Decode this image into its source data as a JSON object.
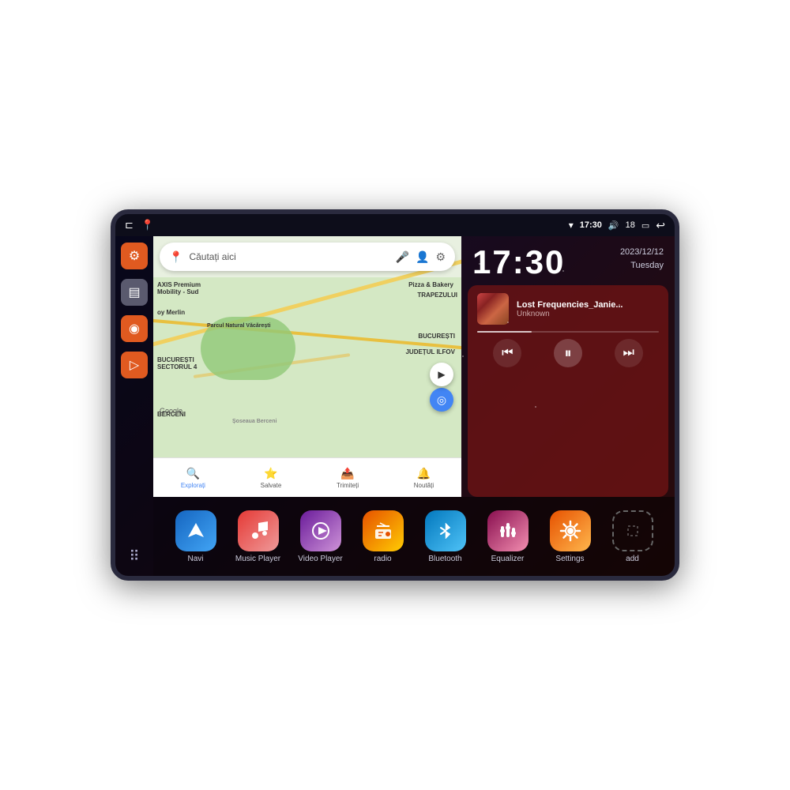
{
  "device": {
    "status_bar": {
      "wifi_icon": "▾",
      "time": "17:30",
      "volume_icon": "🔊",
      "battery_num": "18",
      "battery_icon": "▭",
      "back_icon": "↩"
    },
    "sidebar": {
      "home_icon": "⊏",
      "map_icon": "📍",
      "items": [
        {
          "label": "settings",
          "icon": "⚙",
          "color": "orange"
        },
        {
          "label": "files",
          "icon": "▤",
          "color": "orange"
        },
        {
          "label": "location",
          "icon": "◉",
          "color": "orange"
        },
        {
          "label": "navigation",
          "icon": "▷",
          "color": "orange"
        }
      ],
      "grid_icon": "⠿"
    },
    "map": {
      "search_placeholder": "Căutați aici",
      "search_icon": "🔍",
      "voice_icon": "🎤",
      "account_icon": "👤",
      "places": [
        "AXIS Premium Mobility - Sud",
        "Pizza & Bakery",
        "Parcul Natural Văcărești",
        "BUCUREȘTI",
        "SECTORUL 4",
        "BERCENI",
        "JUDEȚUL ILFOV",
        "TRAPEZULUI"
      ],
      "bottom_tabs": [
        {
          "label": "Explorați",
          "icon": "🔍",
          "active": true
        },
        {
          "label": "Salvate",
          "icon": "⭐",
          "active": false
        },
        {
          "label": "Trimiteți",
          "icon": "📤",
          "active": false
        },
        {
          "label": "Noutăți",
          "icon": "🔔",
          "active": false
        }
      ],
      "google_label": "Google"
    },
    "clock": {
      "time": "17:30",
      "date": "2023/12/12",
      "day": "Tuesday"
    },
    "music_widget": {
      "title": "Lost Frequencies_Janie...",
      "artist": "Unknown",
      "prev_icon": "⏮",
      "play_icon": "⏸",
      "next_icon": "⏭"
    },
    "apps": [
      {
        "label": "Navi",
        "icon": "▷",
        "color": "navi"
      },
      {
        "label": "Music Player",
        "icon": "🎵",
        "color": "music"
      },
      {
        "label": "Video Player",
        "icon": "▶",
        "color": "video"
      },
      {
        "label": "radio",
        "icon": "📻",
        "color": "radio"
      },
      {
        "label": "Bluetooth",
        "icon": "⚡",
        "color": "bluetooth"
      },
      {
        "label": "Equalizer",
        "icon": "🎚",
        "color": "equalizer"
      },
      {
        "label": "Settings",
        "icon": "⚙",
        "color": "settings"
      },
      {
        "label": "add",
        "icon": "+",
        "color": "add"
      }
    ]
  }
}
